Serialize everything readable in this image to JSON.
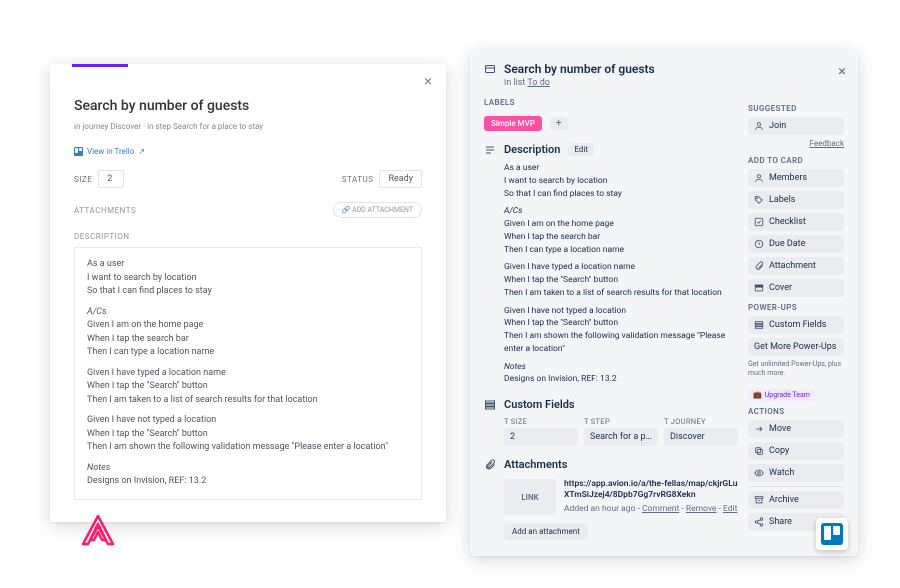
{
  "left": {
    "title": "Search by number of guests",
    "close": "×",
    "crumb_prefix": "in journey ",
    "crumb_journey": "Discover",
    "crumb_mid": " · in step ",
    "crumb_step": "Search for a place to stay",
    "trello_link": "View in Trello",
    "size_label": "SIZE",
    "size_value": "2",
    "status_label": "STATUS",
    "status_value": "Ready",
    "attachments_label": "ATTACHMENTS",
    "add_attachment_btn": "ADD ATTACHMENT",
    "description_label": "DESCRIPTION",
    "desc_p1": "As a user",
    "desc_p2": "I want to search by location",
    "desc_p3": "So that I can find places to stay",
    "desc_ac": "A/Cs",
    "desc_b1": "Given I am on the home page",
    "desc_b2": "When I tap the search bar",
    "desc_b3": "Then I can type a location name",
    "desc_c1": "Given I have typed a location name",
    "desc_c2": "When I tap the \"Search\" button",
    "desc_c3": "Then I am taken to a list of search results for that location",
    "desc_d1": "Given I have not typed a location",
    "desc_d2": "When I tap the \"Search\" button",
    "desc_d3": "Then I am shown the following validation message \"Please enter a location\"",
    "desc_notes_h": "Notes",
    "desc_notes": "Designs on Invision, REF: 13.2"
  },
  "right": {
    "title": "Search by number of guests",
    "close": "×",
    "inlist_prefix": "in list ",
    "inlist_name": "To do",
    "labels_label": "LABELS",
    "chip": "Simple MVP",
    "plus": "+",
    "desc_h": "Description",
    "edit": "Edit",
    "desc_p1": "As a user",
    "desc_p2": "I want to search by location",
    "desc_p3": "So that I can find places to stay",
    "desc_ac": "A/Cs",
    "desc_b1": "Given I am on the home page",
    "desc_b2": "When I tap the search bar",
    "desc_b3": "Then I can type a location name",
    "desc_c1": "Given I have typed a location name",
    "desc_c2": "When I tap the \"Search\" button",
    "desc_c3": "Then I am taken to a list of search results for that location",
    "desc_d1": "Given I have not typed a location",
    "desc_d2": "When I tap the \"Search\" button",
    "desc_d3": "Then I am shown the following validation message \"Please enter a location\"",
    "desc_notes_h": "Notes",
    "desc_notes": "Designs on Invision, REF: 13.2",
    "cf_h": "Custom Fields",
    "cf_size_l": "SIZE",
    "cf_size_v": "2",
    "cf_step_l": "STEP",
    "cf_step_v": "Search for a place ...",
    "cf_journey_l": "JOURNEY",
    "cf_journey_v": "Discover",
    "att_h": "Attachments",
    "att_thumb": "LINK",
    "att_url": "https://app.avion.io/a/the-fellas/map/ckjrGLuXTmSiJzej4/8Dpb7Gg7rvRG8Xekn",
    "att_sub_a": "Added an hour ago - ",
    "att_sub_c": "Comment",
    "att_sub_r": "Remove",
    "att_sub_e": "Edit",
    "att_dash": " - ",
    "add_att": "Add an attachment",
    "side": {
      "suggested": "SUGGESTED",
      "join": "Join",
      "feedback": "Feedback",
      "add_h": "ADD TO CARD",
      "members": "Members",
      "labels": "Labels",
      "checklist": "Checklist",
      "duedate": "Due Date",
      "attachment": "Attachment",
      "cover": "Cover",
      "pu_h": "POWER-UPS",
      "cf": "Custom Fields",
      "more_pu": "Get More Power-Ups",
      "promo": "Get unlimited Power-Ups, plus much more.",
      "upgrade": "Upgrade Team",
      "actions_h": "ACTIONS",
      "move": "Move",
      "copy": "Copy",
      "watch": "Watch",
      "archive": "Archive",
      "share": "Share"
    }
  }
}
